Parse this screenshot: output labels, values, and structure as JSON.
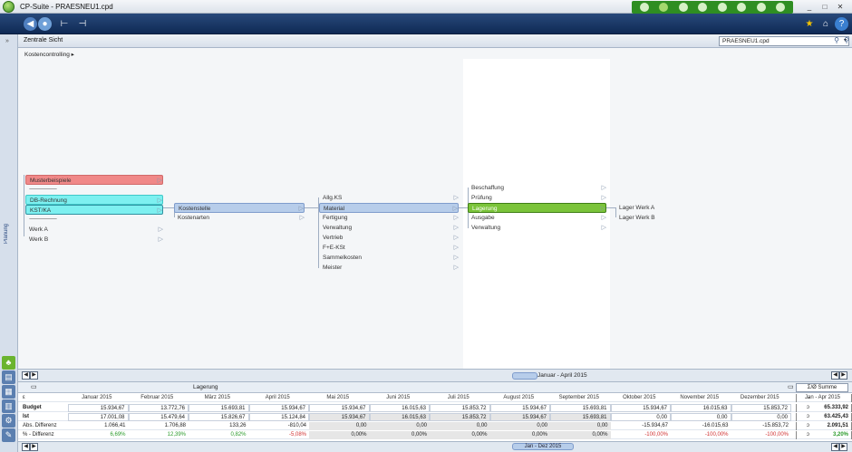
{
  "window": {
    "title": "CP-Suite - PRAESNEU1.cpd"
  },
  "icons": {
    "app": "app-globe-icon",
    "back": "back-arrow-icon",
    "globe": "globe-icon",
    "tree1": "tree-structure-icon",
    "tree2": "tree-split-icon",
    "star": "star-icon",
    "home": "home-icon",
    "help": "help-icon"
  },
  "navbar": {
    "title": "Zentrale Sicht",
    "file": "PRAESNEU1.cpd"
  },
  "leftstrip": {
    "tab": "Planung"
  },
  "breadcrumb": "Kostencontrolling ▸",
  "col1": {
    "items": [
      {
        "label": "Musterbeispiele",
        "style": "red"
      },
      {
        "label": "------------------------------",
        "style": "sep"
      },
      {
        "label": "DB-Rechnung",
        "style": "cyan"
      },
      {
        "label": "KST/KA",
        "style": "cyansel"
      },
      {
        "label": "------------------------------",
        "style": "sep"
      },
      {
        "label": "Werk A",
        "style": "plain"
      },
      {
        "label": "Werk B",
        "style": "plain"
      }
    ]
  },
  "col2": {
    "items": [
      {
        "label": "Kostenstelle",
        "style": "blue"
      },
      {
        "label": "Kostenarten",
        "style": "plain"
      }
    ]
  },
  "col3": {
    "items": [
      {
        "label": "Allg.KS",
        "style": "plain"
      },
      {
        "label": "Material",
        "style": "blue"
      },
      {
        "label": "Fertigung",
        "style": "plain"
      },
      {
        "label": "Verwaltung",
        "style": "plain"
      },
      {
        "label": "Vertrieb",
        "style": "plain"
      },
      {
        "label": "F+E-KSt",
        "style": "plain"
      },
      {
        "label": "Sammelkosten",
        "style": "plain"
      },
      {
        "label": "Meister",
        "style": "plain"
      }
    ]
  },
  "col4": {
    "items": [
      {
        "label": "Beschaffung",
        "style": "plain"
      },
      {
        "label": "Prüfung",
        "style": "plain"
      },
      {
        "label": "Lagerung",
        "style": "green"
      },
      {
        "label": "Ausgabe",
        "style": "plain"
      },
      {
        "label": "Verwaltung",
        "style": "plain"
      }
    ]
  },
  "col5": {
    "items": [
      {
        "label": "Lager Werk A",
        "style": "plain"
      },
      {
        "label": "Lager Werk B",
        "style": "plain"
      }
    ]
  },
  "scroll1": {
    "label": "Januar - April 2015"
  },
  "table": {
    "title": "Lagerung",
    "corner": "ε",
    "months": [
      "Januar 2015",
      "Februar 2015",
      "März 2015",
      "April 2015",
      "Mai 2015",
      "Juni 2015",
      "Juli 2015",
      "August 2015",
      "September 2015",
      "Oktober 2015",
      "November 2015",
      "Dezember 2015"
    ],
    "sum_head": "Jan - Apr 2015",
    "sum_btn": "Σ/Ø Summe",
    "rows": [
      {
        "label": "Budget",
        "vals": [
          "15.934,67",
          "13.772,76",
          "15.693,81",
          "15.934,67",
          "15.934,67",
          "16.015,63",
          "15.853,72",
          "15.934,67",
          "15.693,81",
          "15.934,67",
          "16.015,63",
          "15.853,72"
        ],
        "sum": "65.333,92"
      },
      {
        "label": "Ist",
        "vals": [
          "17.001,08",
          "15.479,64",
          "15.826,67",
          "15.124,84",
          "15.934,67",
          "16.015,63",
          "15.853,72",
          "15.934,67",
          "15.693,81",
          "0,00",
          "0,00",
          "0,00"
        ],
        "sum": "63.425,43"
      },
      {
        "label": "Abs. Differenz",
        "vals": [
          "1.066,41",
          "1.706,88",
          "133,26",
          "-810,04",
          "0,00",
          "0,00",
          "0,00",
          "0,00",
          "0,00",
          "-15.934,67",
          "-16.015,63",
          "-15.853,72"
        ],
        "sum": "2.091,51"
      },
      {
        "label": "% - Differenz",
        "vals": [
          "6,69%",
          "12,39%",
          "0,82%",
          "-5,08%",
          "0,00%",
          "0,00%",
          "0,00%",
          "0,00%",
          "0,00%",
          "-100,00%",
          "-100,00%",
          "-100,00%"
        ],
        "sum": "3,20%"
      }
    ]
  },
  "scroll2": {
    "label": "Jan - Dez 2015"
  }
}
